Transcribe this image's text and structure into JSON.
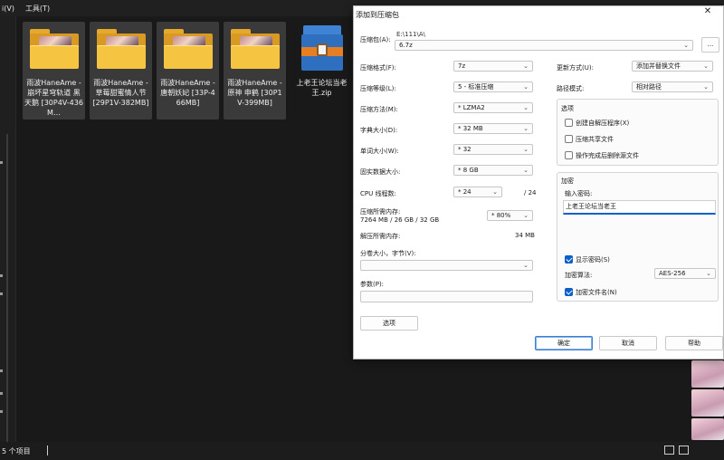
{
  "explorer": {
    "menu": [
      "i(V)",
      "工具(T)"
    ],
    "items": [
      {
        "name": "雨波HaneAme - 崩坏星穹轨道 黑天鹅 [30P4V-436M…",
        "type": "folder"
      },
      {
        "name": "雨波HaneAme - 草莓甜蜜情人节 [29P1V-382MB]",
        "type": "folder"
      },
      {
        "name": "雨波HaneAme - 唐朝妖妃 [33P-466MB]",
        "type": "folder"
      },
      {
        "name": "雨波HaneAme - 原神 申鹤 [30P1V-399MB]",
        "type": "folder"
      },
      {
        "name": "上老王论坛当老王.zip",
        "type": "archive"
      }
    ],
    "status": "5 个项目"
  },
  "dialog": {
    "title": "添加到压缩包",
    "close": "✕",
    "archive_label": "压缩包(A):",
    "archive_path": "E:\\111\\A\\",
    "archive_name": "6.7z",
    "browse": "...",
    "left": [
      {
        "label": "压缩格式(F):",
        "value": "7z"
      },
      {
        "label": "压缩等级(L):",
        "value": "5 - 标准压缩"
      },
      {
        "label": "压缩方法(M):",
        "value": "* LZMA2"
      },
      {
        "label": "字典大小(D):",
        "value": "* 32 MB"
      },
      {
        "label": "单词大小(W):",
        "value": "* 32"
      },
      {
        "label": "固实数据大小:",
        "value": "* 8 GB"
      }
    ],
    "cpu_label": "CPU 线程数:",
    "cpu_value": "* 24",
    "cpu_total": "/ 24",
    "mem_comp_label": "压缩所需内存:",
    "mem_comp_detail": "7264 MB / 26 GB / 32 GB",
    "mem_comp_value": "* 80%",
    "mem_decomp_label": "解压所需内存:",
    "mem_decomp_value": "34 MB",
    "split_label": "分卷大小，字节(V):",
    "split_value": "",
    "params_label": "参数(P):",
    "params_value": "",
    "options_button": "选项",
    "update_label": "更新方式(U):",
    "update_value": "添加并替换文件",
    "pathmode_label": "路径模式:",
    "pathmode_value": "相对路径",
    "options_group": "选项",
    "option_sfx": "创建自解压程序(X)",
    "option_shared": "压缩共享文件",
    "option_delete": "操作完成后删除源文件",
    "encrypt_group": "加密",
    "password_label": "输入密码:",
    "password_value": "上老王论坛当老王",
    "show_password": "显示密码(S)",
    "enc_method_label": "加密算法:",
    "enc_method_value": "AES-256",
    "encrypt_names": "加密文件名(N)",
    "ok": "确定",
    "cancel": "取消",
    "help": "帮助"
  }
}
